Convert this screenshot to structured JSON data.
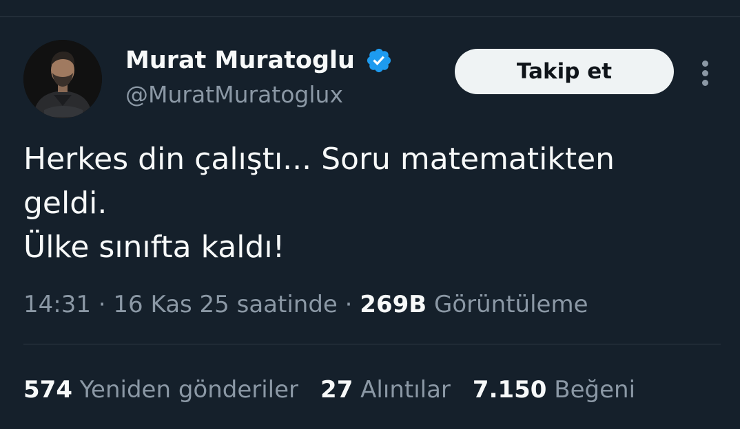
{
  "user": {
    "display_name": "Murat Muratoglu",
    "handle": "@MuratMuratoglux",
    "verified": true
  },
  "actions": {
    "follow_label": "Takip et"
  },
  "tweet": {
    "lines": [
      "Herkes din çalıştı... Soru matematikten",
      "geldi.",
      "Ülke sınıfta kaldı!"
    ],
    "time": "14:31",
    "date": "16 Kas 25 saatinde",
    "separator": "·",
    "views_count": "269B",
    "views_label": "Görüntüleme"
  },
  "stats": {
    "reposts_count": "574",
    "reposts_label": "Yeniden gönderiler",
    "quotes_count": "27",
    "quotes_label": "Alıntılar",
    "likes_count": "7.150",
    "likes_label": "Beğeni"
  },
  "colors": {
    "background": "#15202b",
    "primary_text": "#f7f9f9",
    "secondary_text": "#8b98a5",
    "verified_blue": "#1d9bf0",
    "follow_button_bg": "#eff3f4",
    "divider": "#2f3a45"
  }
}
